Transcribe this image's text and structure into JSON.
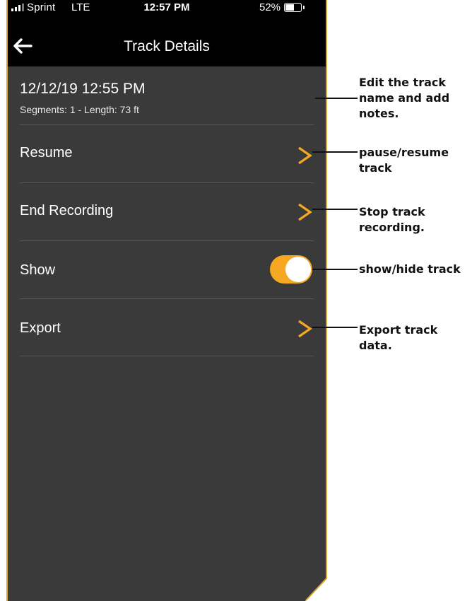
{
  "status_bar": {
    "carrier": "Sprint",
    "network": "LTE",
    "time": "12:57 PM",
    "battery_percent": "52%",
    "battery_level": 0.52
  },
  "nav": {
    "title": "Track Details",
    "back_icon": "back-arrow-icon"
  },
  "track": {
    "name": "12/12/19 12:55 PM",
    "meta": "Segments: 1  -  Length: 73 ft"
  },
  "rows": {
    "resume": "Resume",
    "end_recording": "End Recording",
    "show": "Show",
    "export": "Export"
  },
  "show_toggle": {
    "on": true
  },
  "annotations": {
    "edit": "Edit the track name and add notes.",
    "resume": "pause/resume track",
    "end": "Stop track recording.",
    "show": "show/hide track",
    "export": "Export track data."
  },
  "colors": {
    "accent": "#f6a822",
    "background": "#3a3a3a",
    "bar": "#000000"
  }
}
